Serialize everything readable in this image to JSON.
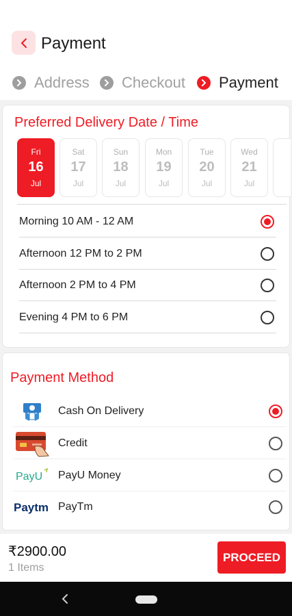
{
  "header": {
    "title": "Payment"
  },
  "steps": [
    {
      "label": "Address",
      "state": "done"
    },
    {
      "label": "Checkout",
      "state": "done"
    },
    {
      "label": "Payment",
      "state": "current"
    }
  ],
  "delivery": {
    "title": "Preferred Delivery Date / Time",
    "dates": [
      {
        "day": "Fri",
        "num": "16",
        "month": "Jul",
        "selected": true
      },
      {
        "day": "Sat",
        "num": "17",
        "month": "Jul",
        "selected": false
      },
      {
        "day": "Sun",
        "num": "18",
        "month": "Jul",
        "selected": false
      },
      {
        "day": "Mon",
        "num": "19",
        "month": "Jul",
        "selected": false
      },
      {
        "day": "Tue",
        "num": "20",
        "month": "Jul",
        "selected": false
      },
      {
        "day": "Wed",
        "num": "21",
        "month": "Jul",
        "selected": false
      }
    ],
    "slots": [
      {
        "label": "Morning 10 AM - 12 AM",
        "selected": true
      },
      {
        "label": "Afternoon 12 PM to 2 PM",
        "selected": false
      },
      {
        "label": "Afternoon 2 PM to 4 PM",
        "selected": false
      },
      {
        "label": "Evening 4 PM to 6 PM",
        "selected": false
      }
    ]
  },
  "payment": {
    "title": "Payment Method",
    "methods": [
      {
        "label": "Cash On Delivery",
        "icon": "cash-on-delivery-icon",
        "selected": true
      },
      {
        "label": "Credit",
        "icon": "credit-card-icon",
        "selected": false
      },
      {
        "label": "PayU Money",
        "icon": "payu-logo",
        "logo_text": "PayU",
        "selected": false
      },
      {
        "label": "PayTm",
        "icon": "paytm-logo",
        "logo_text": "Paytm",
        "selected": false
      }
    ]
  },
  "footer": {
    "total": "₹2900.00",
    "items": "1 Items",
    "proceed_label": "PROCEED"
  },
  "colors": {
    "accent": "#ee1c25",
    "step_inactive": "#9e9e9e"
  }
}
